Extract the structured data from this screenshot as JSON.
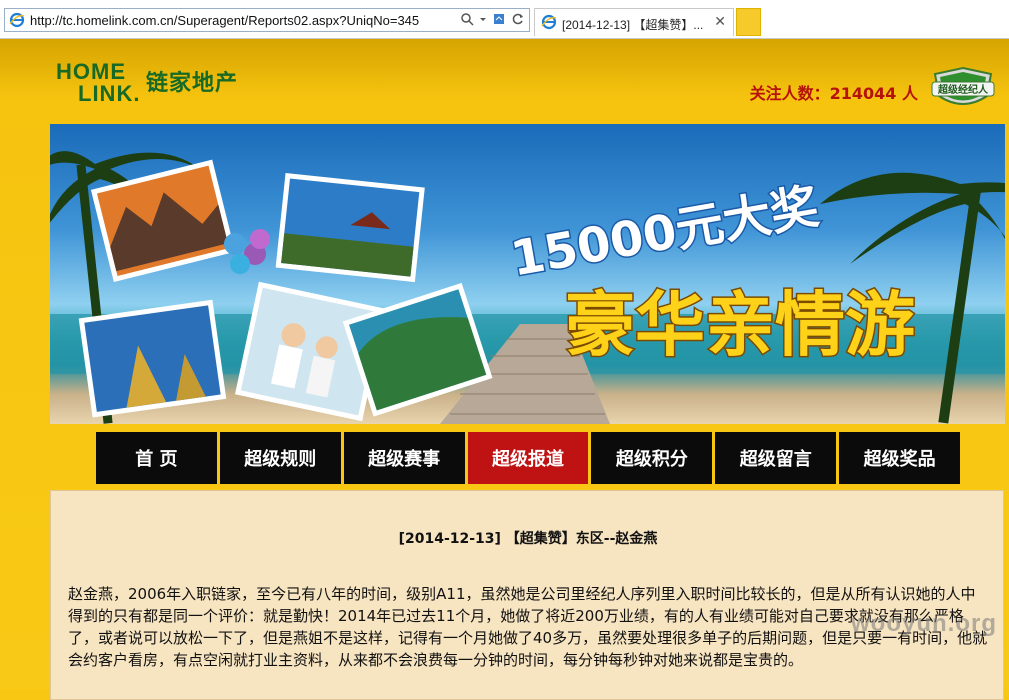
{
  "browser": {
    "url": "http://tc.homelink.com.cn/Superagent/Reports02.aspx?UniqNo=345",
    "tab_title": "[2014-12-13] 【超集赞】...",
    "close_glyph": "✕"
  },
  "site": {
    "logo_home": "HOME",
    "logo_link": "LINK.",
    "logo_cn": "链家地产",
    "followers": "关注人数：214044 人",
    "badge_text": "超级经纪人"
  },
  "banner": {
    "line1": "15000元大奖",
    "line2": "豪华亲情游"
  },
  "nav": {
    "items": [
      "首 页",
      "超级规则",
      "超级赛事",
      "超级报道",
      "超级积分",
      "超级留言",
      "超级奖品"
    ],
    "active_index": 3
  },
  "article": {
    "title": "[2014-12-13] 【超集赞】东区--赵金燕",
    "body": "赵金燕，2006年入职链家，至今已有八年的时间，级别A11，虽然她是公司里经纪人序列里入职时间比较长的，但是从所有认识她的人中得到的只有都是同一个评价：就是勤快！2014年已过去11个月，她做了将近200万业绩，有的人有业绩可能对自己要求就没有那么严格了，或者说可以放松一下了，但是燕姐不是这样，记得有一个月她做了40多万，虽然要处理很多单子的后期问题，但是只要一有时间，他就会约客户看房，有点空闲就打业主资料，从来都不会浪费每一分钟的时间，每分钟每秒钟对她来说都是宝贵的。"
  },
  "watermark": "wooyun.org",
  "colors": {
    "page_bg": "#f7c713",
    "nav_bg": "#0b0b0b",
    "nav_active": "#bf1212",
    "content_bg": "#f7e4c1",
    "logo_green": "#176a25",
    "follower_red": "#b5120c"
  }
}
